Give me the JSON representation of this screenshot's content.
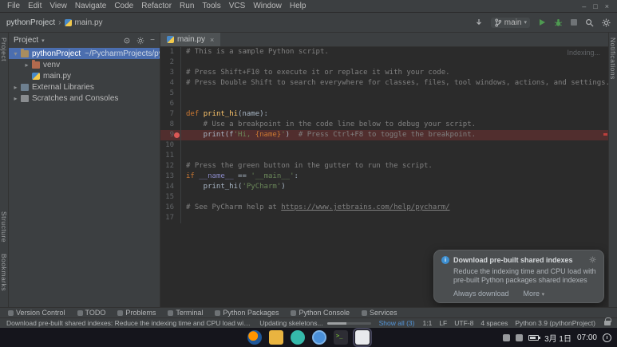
{
  "menu": {
    "items": [
      "File",
      "Edit",
      "View",
      "Navigate",
      "Code",
      "Refactor",
      "Run",
      "Tools",
      "VCS",
      "Window",
      "Help"
    ]
  },
  "window_controls": {
    "minimize": "–",
    "maximize": "□",
    "close": "×"
  },
  "navbar": {
    "project": "pythonProject",
    "separator": "›",
    "file": "main.py",
    "branch": "main",
    "branch_arrow": "▾"
  },
  "left_stripe": {
    "items": [
      "Project",
      "Structure",
      "Bookmarks"
    ]
  },
  "right_stripe": {
    "items": [
      "Notifications"
    ]
  },
  "project_panel": {
    "title": "Project",
    "title_arrow": "▾",
    "tree": [
      {
        "label": "pythonProject",
        "path": " ~/PycharmProjects/pythonProject",
        "icon": "folder",
        "chevron": "▾",
        "level": 0,
        "selected": true
      },
      {
        "label": "venv",
        "icon": "folder-excluded",
        "chevron": "▸",
        "level": 1
      },
      {
        "label": "main.py",
        "icon": "python",
        "chevron": "",
        "level": 1
      },
      {
        "label": "External Libraries",
        "icon": "libraries",
        "chevron": "▸",
        "level": 0
      },
      {
        "label": "Scratches and Consoles",
        "icon": "scratches",
        "chevron": "▸",
        "level": 0
      }
    ]
  },
  "editor": {
    "tab": {
      "label": "main.py",
      "close": "×"
    },
    "indexing": "Indexing...",
    "breakpoint_line": 9,
    "lines": [
      {
        "n": 1,
        "seg": [
          [
            "c",
            "# This is a sample Python script."
          ]
        ]
      },
      {
        "n": 2,
        "seg": []
      },
      {
        "n": 3,
        "seg": [
          [
            "c",
            "# Press Shift+F10 to execute it or replace it with your code."
          ]
        ]
      },
      {
        "n": 4,
        "seg": [
          [
            "c",
            "# Press Double Shift to search everywhere for classes, files, tool windows, actions, and settings."
          ]
        ]
      },
      {
        "n": 5,
        "seg": []
      },
      {
        "n": 6,
        "seg": []
      },
      {
        "n": 7,
        "seg": [
          [
            "k",
            "def "
          ],
          [
            "f",
            "print_hi"
          ],
          [
            "t",
            "(name):"
          ]
        ]
      },
      {
        "n": 8,
        "seg": [
          [
            "c",
            "    # Use a breakpoint in the code line below to debug your script."
          ]
        ]
      },
      {
        "n": 9,
        "seg": [
          [
            "t",
            "    print(f"
          ],
          [
            "s",
            "'Hi, "
          ],
          [
            "b",
            "{name}"
          ],
          [
            "s",
            "'"
          ],
          [
            "t",
            ")  "
          ],
          [
            "c",
            "# Press Ctrl+F8 to toggle the breakpoint."
          ]
        ]
      },
      {
        "n": 10,
        "seg": []
      },
      {
        "n": 11,
        "seg": []
      },
      {
        "n": 12,
        "seg": [
          [
            "c",
            "# Press the green button in the gutter to run the script."
          ]
        ]
      },
      {
        "n": 13,
        "seg": [
          [
            "k",
            "if "
          ],
          [
            "d",
            "__name__"
          ],
          [
            "t",
            " == "
          ],
          [
            "s",
            "'__main__'"
          ],
          [
            "t",
            ":"
          ]
        ]
      },
      {
        "n": 14,
        "seg": [
          [
            "t",
            "    print_hi("
          ],
          [
            "s",
            "'PyCharm'"
          ],
          [
            "t",
            ")"
          ]
        ]
      },
      {
        "n": 15,
        "seg": []
      },
      {
        "n": 16,
        "seg": [
          [
            "c",
            "# See PyCharm help at "
          ],
          [
            "cl",
            "https://www.jetbrains.com/help/pycharm/"
          ]
        ]
      },
      {
        "n": 17,
        "seg": []
      }
    ]
  },
  "notification": {
    "title": "Download pre-built shared indexes",
    "body": "Reduce the indexing time and CPU load with pre-built Python packages shared indexes",
    "primary_action": "Always download",
    "secondary_action": "More",
    "secondary_arrow": "▾"
  },
  "bottom_bar": {
    "items": [
      "Version Control",
      "TODO",
      "Problems",
      "Terminal",
      "Python Packages",
      "Python Console",
      "Services"
    ]
  },
  "status_bar": {
    "message": "Download pre-built shared indexes: Reduce the indexing time and CPU load with pre-built... (moments ago)",
    "progress_label": "Updating skeletons...",
    "show_all": "Show all (3)",
    "caret": "1:1",
    "line_ending": "LF",
    "encoding": "UTF-8",
    "indent": "4 spaces",
    "interpreter": "Python 3.9 (pythonProject)"
  },
  "taskbar": {
    "apps": [
      {
        "name": "firefox"
      },
      {
        "name": "files"
      },
      {
        "name": "software"
      },
      {
        "name": "chromium"
      },
      {
        "name": "terminal"
      },
      {
        "name": "active-app",
        "active": true
      }
    ],
    "date": "3月 1日",
    "time": "07:00"
  }
}
